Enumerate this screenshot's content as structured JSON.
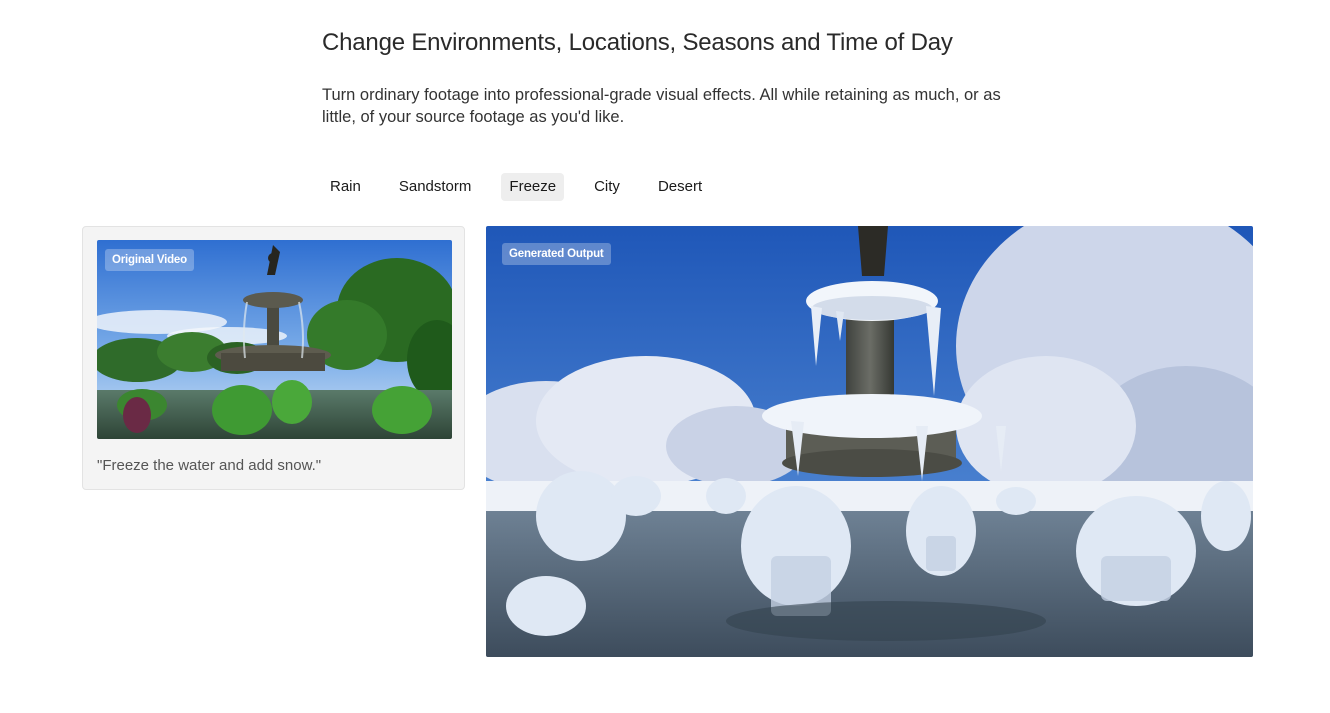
{
  "section": {
    "heading": "Change Environments, Locations, Seasons and Time of Day",
    "description": "Turn ordinary footage into professional-grade visual effects. All while retaining as much, or as little, of your source footage as you'd like."
  },
  "tabs": [
    {
      "label": "Rain",
      "active": false
    },
    {
      "label": "Sandstorm",
      "active": false
    },
    {
      "label": "Freeze",
      "active": true
    },
    {
      "label": "City",
      "active": false
    },
    {
      "label": "Desert",
      "active": false
    }
  ],
  "original": {
    "badge": "Original Video",
    "prompt": "\"Freeze the water and add snow.\""
  },
  "output": {
    "badge": "Generated Output"
  },
  "colors": {
    "active_tab_bg": "#eeeeee",
    "card_bg": "#f4f4f4"
  }
}
